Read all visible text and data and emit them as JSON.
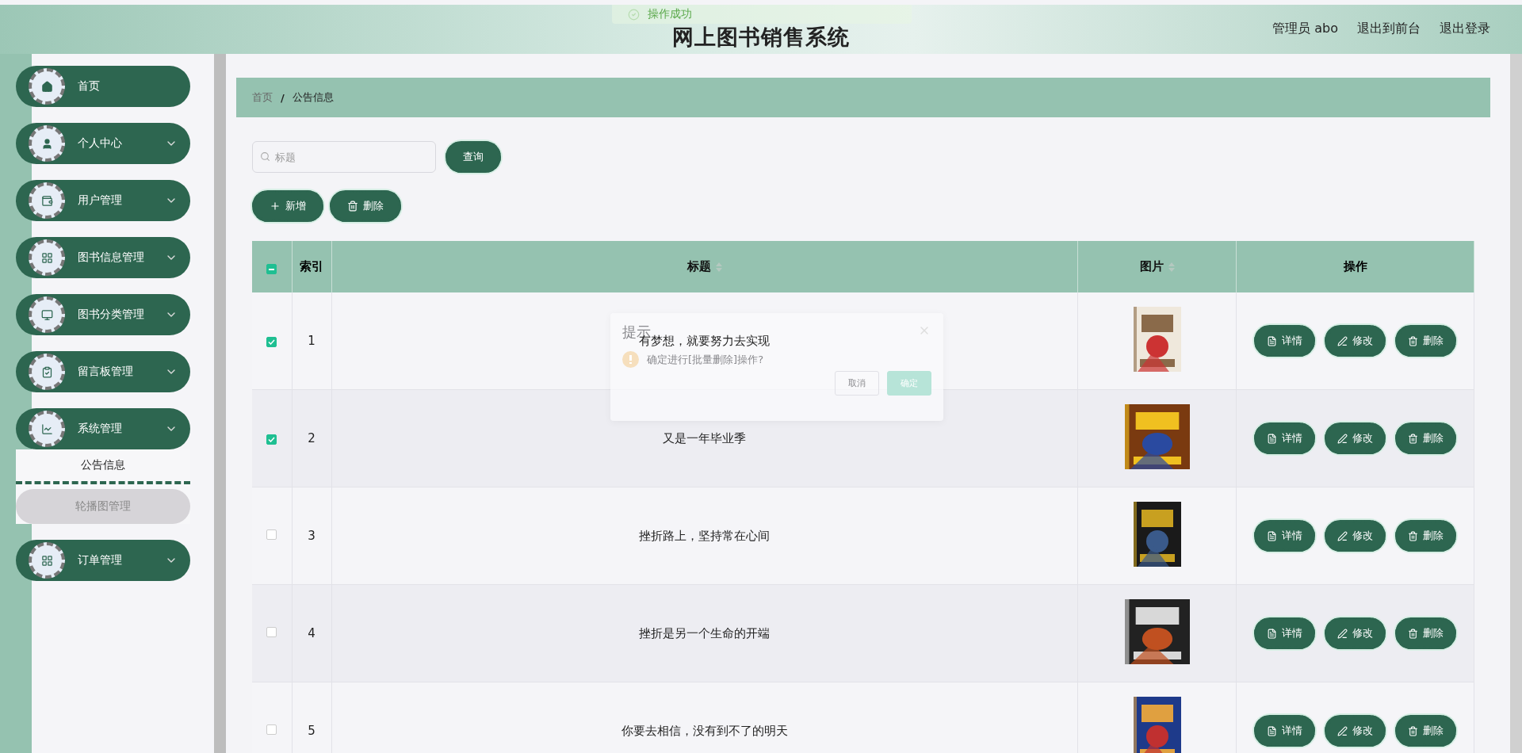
{
  "header": {
    "title": "网上图书销售系统",
    "links": [
      "管理员 abo",
      "退出到前台",
      "退出登录"
    ]
  },
  "toast": {
    "message": "操作成功"
  },
  "sidebar": {
    "items": [
      {
        "label": "首页",
        "kind": "link"
      },
      {
        "label": "个人中心",
        "kind": "submenu"
      },
      {
        "label": "用户管理",
        "kind": "submenu"
      },
      {
        "label": "图书信息管理",
        "kind": "submenu"
      },
      {
        "label": "图书分类管理",
        "kind": "submenu"
      },
      {
        "label": "留言板管理",
        "kind": "submenu"
      },
      {
        "label": "系统管理",
        "kind": "submenu",
        "children": [
          {
            "label": "公告信息",
            "selected": true
          },
          {
            "label": "轮播图管理",
            "selected": false
          }
        ]
      },
      {
        "label": "订单管理",
        "kind": "submenu"
      }
    ]
  },
  "breadcrumb": [
    "首页",
    "公告信息"
  ],
  "breadcrumb_separator": "/",
  "search": {
    "placeholder": "标题",
    "button": "查询"
  },
  "actions": [
    {
      "label": "新增",
      "kind": "add"
    },
    {
      "label": "删除",
      "kind": "delete"
    }
  ],
  "table": {
    "select_all": {
      "indeterminate": true
    },
    "columns": [
      {
        "label": "索引",
        "sortable": false
      },
      {
        "label": "标题",
        "sortable": true
      },
      {
        "label": "图片",
        "sortable": true
      },
      {
        "label": "操作",
        "sortable": false
      }
    ],
    "rows": [
      {
        "checked": true,
        "index": "1",
        "title": "有梦想，就要努力去实现",
        "actions": [
          {
            "label": "详情",
            "kind": "detail"
          },
          {
            "label": "修改",
            "kind": "edit"
          },
          {
            "label": "删除",
            "kind": "delete"
          }
        ]
      },
      {
        "checked": true,
        "index": "2",
        "title": "又是一年毕业季",
        "actions": [
          {
            "label": "详情",
            "kind": "detail"
          },
          {
            "label": "修改",
            "kind": "edit"
          },
          {
            "label": "删除",
            "kind": "delete"
          }
        ]
      },
      {
        "checked": false,
        "index": "3",
        "title": "挫折路上，坚持常在心间",
        "actions": [
          {
            "label": "详情",
            "kind": "detail"
          },
          {
            "label": "修改",
            "kind": "edit"
          },
          {
            "label": "删除",
            "kind": "delete"
          }
        ]
      },
      {
        "checked": false,
        "index": "4",
        "title": "挫折是另一个生命的开端",
        "actions": [
          {
            "label": "详情",
            "kind": "detail"
          },
          {
            "label": "修改",
            "kind": "edit"
          },
          {
            "label": "删除",
            "kind": "delete"
          }
        ]
      },
      {
        "checked": false,
        "index": "5",
        "title": "你要去相信，没有到不了的明天",
        "actions": [
          {
            "label": "详情",
            "kind": "detail"
          },
          {
            "label": "修改",
            "kind": "edit"
          },
          {
            "label": "删除",
            "kind": "delete"
          }
        ]
      }
    ]
  },
  "dialog": {
    "title": "提示",
    "message": "确定进行[批量删除]操作?",
    "buttons": [
      {
        "label": "取消",
        "kind": "cancel"
      },
      {
        "label": "确定",
        "kind": "confirm"
      }
    ]
  }
}
